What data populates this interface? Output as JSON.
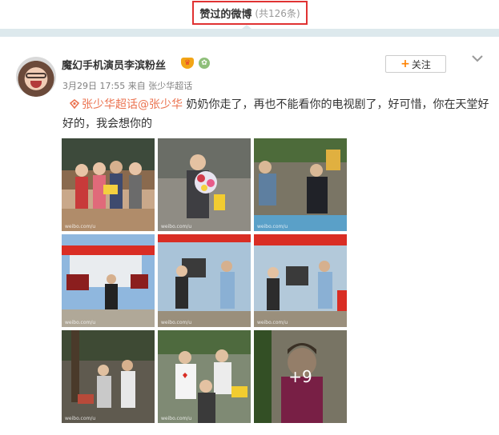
{
  "header": {
    "title": "赞过的微博",
    "count": "(共126条)",
    "colors": {
      "highlight_border": "#e03232",
      "tab_strip": "#dde9ed"
    }
  },
  "post": {
    "author": {
      "name": "魔幻手机演员李滨粉丝",
      "badges": [
        "crown-badge-icon",
        "plant-badge-icon"
      ]
    },
    "meta": {
      "date": "3月29日",
      "time": "17:55",
      "source_prefix": "来自",
      "source": "张少华超话"
    },
    "follow_button": {
      "plus": "+",
      "label": "关注"
    },
    "menu_icon": "chevron-down-icon",
    "text": {
      "topic_link": "张少华超话",
      "mention": "@张少华",
      "body": "奶奶你走了，再也不能看你的电视剧了，好可惜，你在天堂好好的，我会想你的"
    },
    "images": {
      "watermark": "weibo.com/u",
      "more_count": "+9",
      "items": [
        {
          "name": "photo-group-portrait",
          "theme": "group"
        },
        {
          "name": "photo-flowers-bouquet",
          "theme": "flowers"
        },
        {
          "name": "photo-courtyard-talk",
          "theme": "courtyard"
        },
        {
          "name": "photo-film-set-camera",
          "theme": "filmset"
        },
        {
          "name": "photo-film-set-crew",
          "theme": "filmset"
        },
        {
          "name": "photo-film-set-crew-2",
          "theme": "filmset"
        },
        {
          "name": "photo-courtyard-group",
          "theme": "courtyard2"
        },
        {
          "name": "photo-fans-meeting",
          "theme": "fans"
        },
        {
          "name": "photo-laughing-portrait",
          "theme": "portrait"
        }
      ]
    },
    "colors": {
      "link": "#eb7350",
      "follow_plus": "#ff8200",
      "meta": "#808080"
    }
  }
}
